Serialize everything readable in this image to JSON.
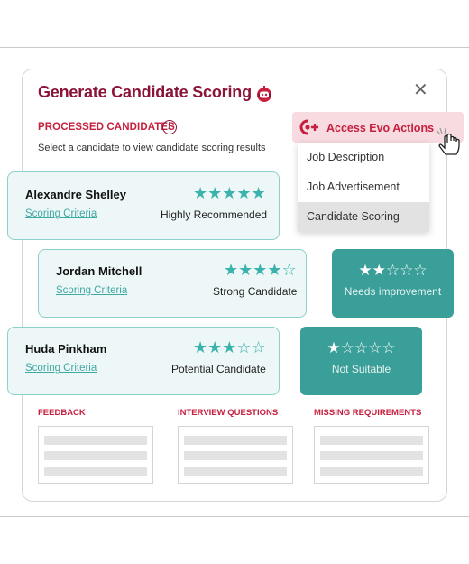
{
  "dialog": {
    "title": "Generate Candidate Scoring",
    "close_symbol": "✕",
    "processed_label": "PROCESSED CANDIDATES",
    "info_symbol": "i",
    "hint": "Select a candidate to view candidate scoring results"
  },
  "evo_menu": {
    "label": "Access Evo Actions",
    "items": [
      {
        "label": "Job Description",
        "selected": false
      },
      {
        "label": "Job Advertisement",
        "selected": false
      },
      {
        "label": "Candidate Scoring",
        "selected": true
      }
    ]
  },
  "candidates": [
    {
      "name": "Alexandre Shelley",
      "link": "Scoring Criteria",
      "rating_label": "Highly Recommended",
      "stars": 5,
      "stars_text": "★★★★★"
    },
    {
      "name": "Jordan Mitchell",
      "link": "Scoring Criteria",
      "rating_label": "Strong Candidate",
      "stars": 4,
      "stars_text": "★★★★☆"
    },
    {
      "name": "Huda Pinkham",
      "link": "Scoring Criteria",
      "rating_label": "Potential Candidate",
      "stars": 3,
      "stars_text": "★★★☆☆"
    }
  ],
  "badges": [
    {
      "stars": 2,
      "stars_text": "★★☆☆☆",
      "label": "Needs improvement"
    },
    {
      "stars": 1,
      "stars_text": "★☆☆☆☆",
      "label": "Not Suitable"
    }
  ],
  "columns": [
    {
      "label": "FEEDBACK"
    },
    {
      "label": "INTERVIEW QUESTIONS"
    },
    {
      "label": "MISSING REQUIREMENTS"
    }
  ],
  "colors": {
    "brand": "#8b1538",
    "accent_red": "#c7203f",
    "teal": "#3bb3ad",
    "teal_dark": "#3a9e99",
    "card_bg": "#eef7f7"
  },
  "icons": {
    "robot": "robot-icon",
    "close": "close-icon",
    "info": "info-icon",
    "evo": "evo-actions-icon",
    "cursor": "hand-pointer-icon"
  }
}
